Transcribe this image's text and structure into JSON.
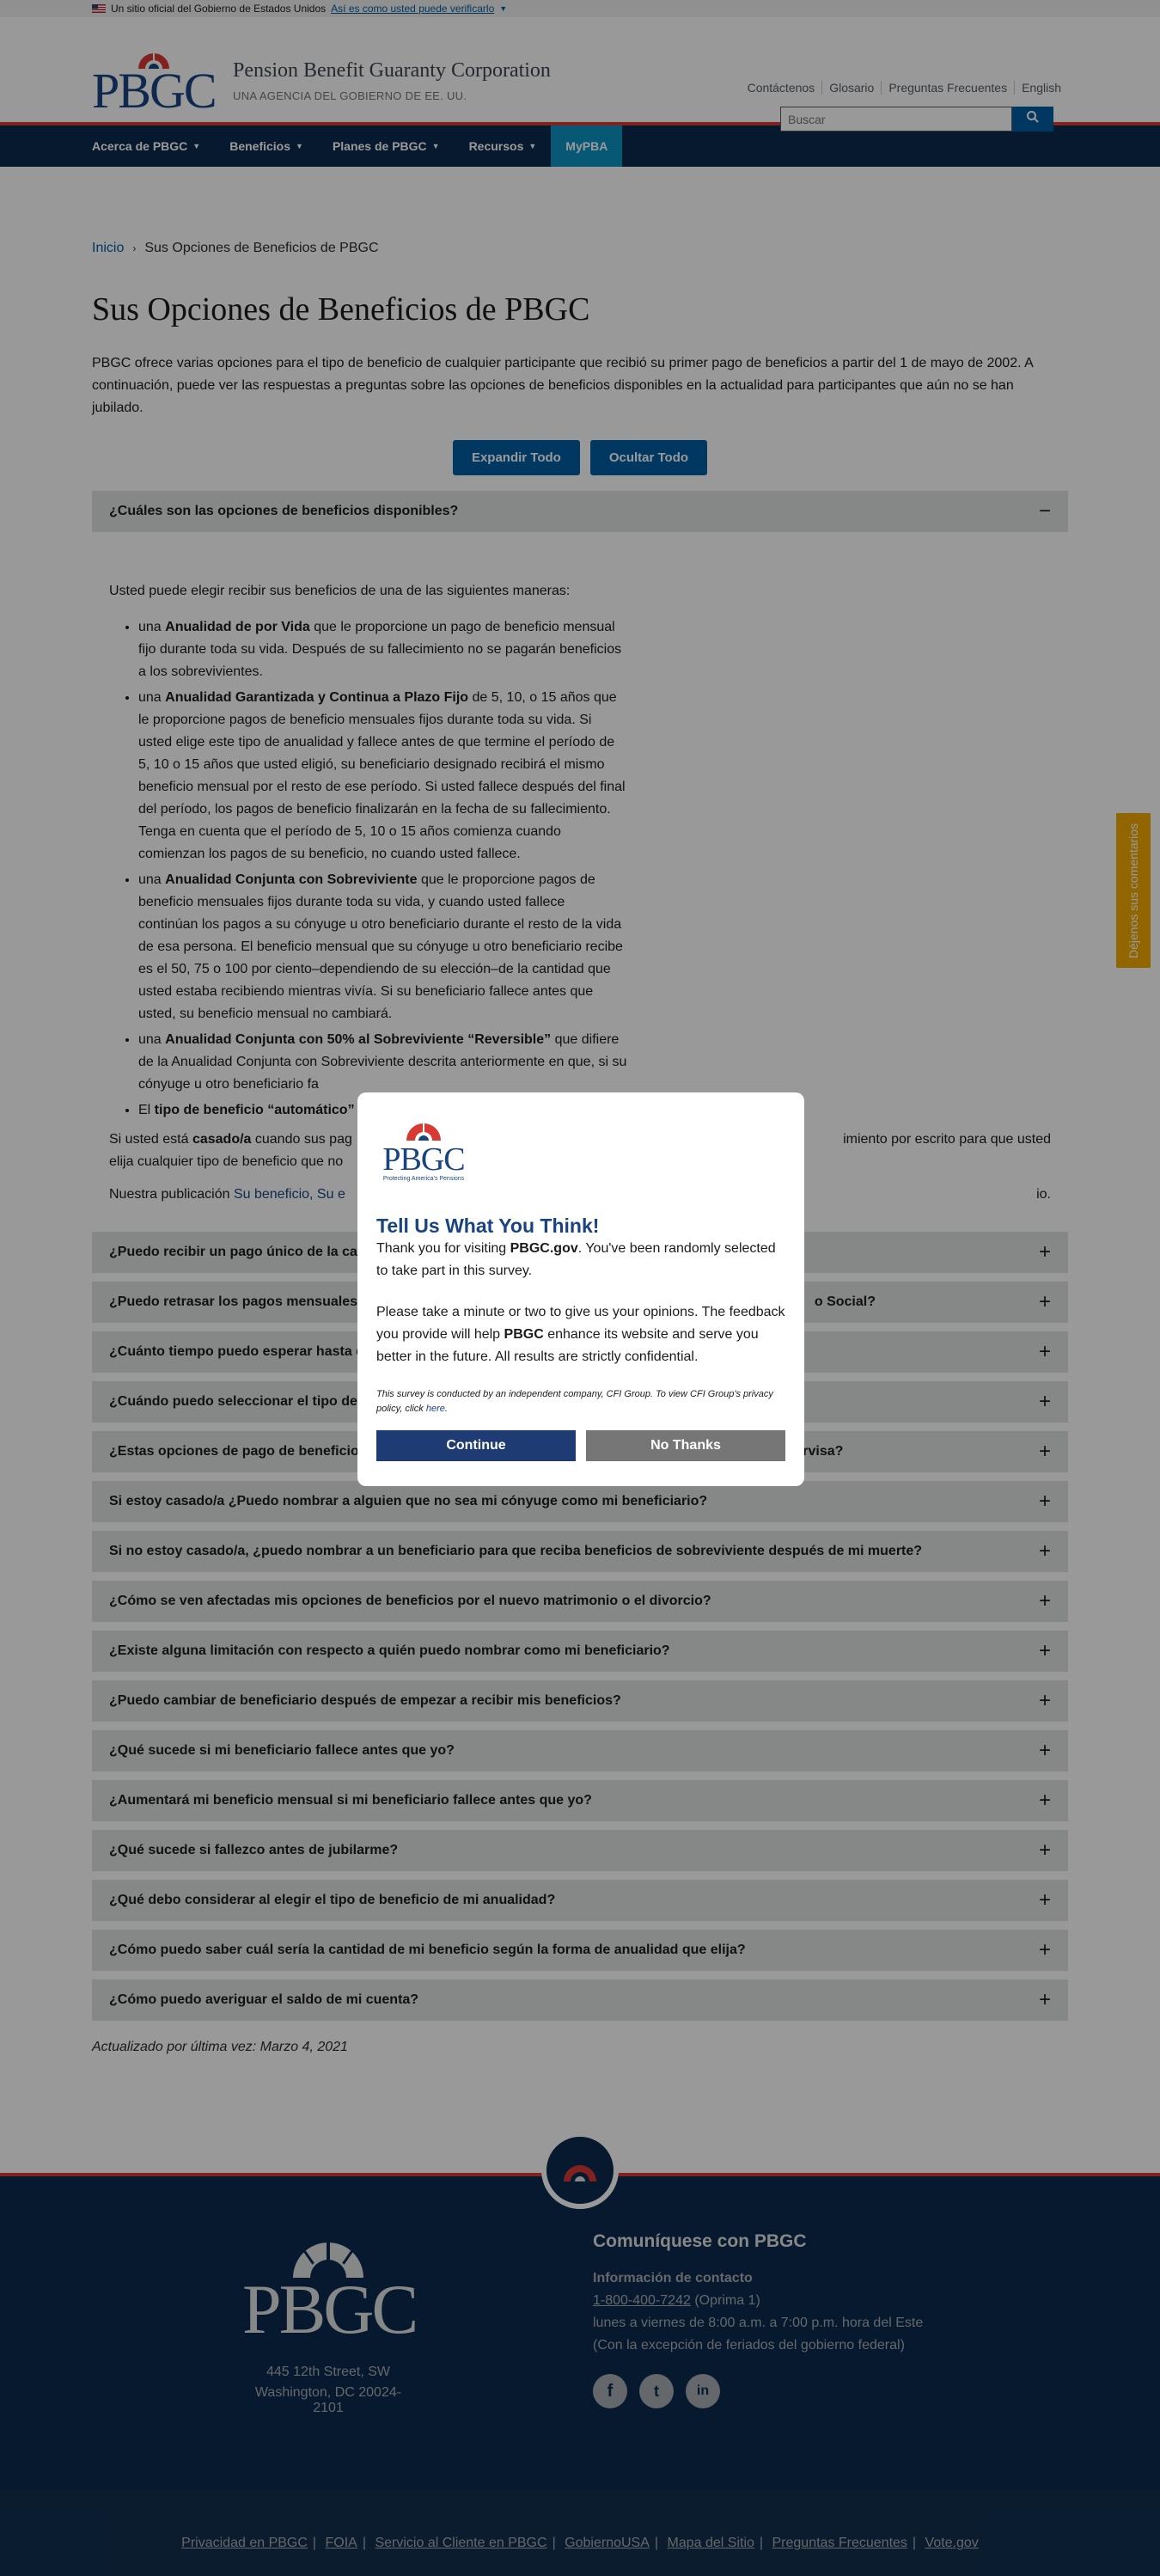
{
  "govbar": {
    "text": "Un sitio oficial del Gobierno de Estados Unidos",
    "link": "Así es como usted puede verificarlo"
  },
  "header": {
    "logo_text": "PBGC",
    "agency_name": "Pension Benefit Guaranty Corporation",
    "agency_sub": "UNA AGENCIA DEL GOBIERNO DE EE. UU.",
    "utility": [
      "Contáctenos",
      "Glosario",
      "Preguntas Frecuentes",
      "English"
    ],
    "search_placeholder": "Buscar"
  },
  "nav": {
    "items": [
      "Acerca de PBGC",
      "Beneficios",
      "Planes de PBGC",
      "Recursos"
    ],
    "mypba": "MyPBA"
  },
  "breadcrumb": {
    "home": "Inicio",
    "current": "Sus Opciones de Beneficios de PBGC"
  },
  "page_title": "Sus Opciones de Beneficios de PBGC",
  "intro": "PBGC ofrece varias opciones para el tipo de beneficio de cualquier participante que recibió su primer pago de beneficios a partir del 1 de mayo de 2002. A continuación, puede ver las respuestas a preguntas sobre las opciones de beneficios disponibles en la actualidad para participantes que aún no se han jubilado.",
  "buttons": {
    "expand": "Expandir Todo",
    "collapse": "Ocultar Todo"
  },
  "first_accordion": {
    "title": "¿Cuáles son las opciones de beneficios disponibles?",
    "lead": "Usted puede elegir recibir sus beneficios de una de las siguientes maneras:",
    "items": [
      {
        "pre": "una ",
        "bold": "Anualidad de por Vida",
        "post": " que le proporcione un pago de beneficio mensual fijo durante toda su vida. Después de su fallecimiento no se pagarán beneficios a los sobrevivientes."
      },
      {
        "pre": "una ",
        "bold": "Anualidad Garantizada y Continua a Plazo Fijo",
        "post": " de 5, 10, o 15 años que le proporcione pagos de beneficio mensuales fijos durante toda su vida. Si usted elige este tipo de anualidad y fallece antes de que termine el período de 5, 10 o 15 años que usted eligió, su beneficiario designado recibirá el mismo beneficio mensual por el resto de ese período. Si usted fallece después del final del período, los pagos de beneficio finalizarán en la fecha de su fallecimiento. Tenga en cuenta que el período de 5, 10 o 15 años comienza cuando comienzan los pagos de su beneficio, no cuando usted fallece."
      },
      {
        "pre": "una ",
        "bold": "Anualidad Conjunta con Sobreviviente",
        "post": " que le proporcione pagos de beneficio mensuales fijos durante toda su vida, y cuando usted fallece continúan los pagos a su cónyuge u otro beneficiario durante el resto de la vida de esa persona. El beneficio mensual que su cónyuge u otro beneficiario recibe es el 50, 75 o 100 por ciento–dependiendo de su elección–de la cantidad que usted estaba recibiendo mientras vivía. Si su beneficiario fallece antes que usted, su beneficio mensual no cambiará."
      },
      {
        "pre": "una ",
        "bold": "Anualidad Conjunta con 50% al Sobreviviente “Reversible”",
        "post": " que difiere de la Anualidad Conjunta con Sobreviviente descrita anteriormente en que, si su cónyuge u otro beneficiario fa"
      },
      {
        "pre": "El ",
        "bold": "tipo de beneficio “automático”",
        "post": ""
      }
    ],
    "married_pre": "Si usted está ",
    "married_bold": "casado/a",
    "married_post": " cuando sus pag",
    "married_tail": "imiento por escrito para que usted",
    "married_line2": "elija cualquier tipo de beneficio que no",
    "pub_pre": "Nuestra publicación ",
    "pub_link": "Su beneficio, Su e",
    "pub_tail": "io."
  },
  "accordions": [
    "¿Puedo recibir un pago único de la can",
    "¿Puedo retrasar los pagos mensuales",
    "¿Cuánto tiempo puedo esperar hasta q",
    "¿Cuándo puedo seleccionar el tipo de",
    "¿Estas opciones de pago de beneficios están disponibles en todos los planes de pensión que PBGC supervisa?",
    "Si estoy casado/a ¿Puedo nombrar a alguien que no sea mi cónyuge como mi beneficiario?",
    "Si no estoy casado/a, ¿puedo nombrar a un beneficiario para que reciba beneficios de sobreviviente después de mi muerte?",
    "¿Cómo se ven afectadas mis opciones de beneficios por el nuevo matrimonio o el divorcio?",
    "¿Existe alguna limitación con respecto a quién puedo nombrar como mi beneficiario?",
    "¿Puedo cambiar de beneficiario después de empezar a recibir mis beneficios?",
    "¿Qué sucede si mi beneficiario fallece antes que yo?",
    "¿Aumentará mi beneficio mensual si mi beneficiario fallece antes que yo?",
    "¿Qué sucede si fallezco antes de jubilarme?",
    "¿Qué debo considerar al elegir el tipo de beneficio de mi anualidad?",
    "¿Cómo puedo saber cuál sería la cantidad de mi beneficio según la forma de anualidad que elija?",
    "¿Cómo puedo averiguar el saldo de mi cuenta?"
  ],
  "accordion_tail_2": "o Social?",
  "updated": "Actualizado por última vez: Marzo 4, 2021",
  "feedback_tab": "Déjenos sus comentarios",
  "modal": {
    "logo_text": "PBGC",
    "logo_tagline": "Protecting America's Pensions",
    "title": "Tell Us What You Think!",
    "p1_pre": "Thank you for visiting ",
    "p1_bold": "PBGC.gov",
    "p1_post": ". You've been randomly selected to take part in this survey.",
    "p2_pre": "Please take a minute or two to give us your opinions. The feedback you provide will help ",
    "p2_bold": "PBGC",
    "p2_post": " enhance its website and serve you better in the future. All results are strictly confidential.",
    "small_pre": "This survey is conducted by an independent company, CFI Group. To view CFI Group's privacy policy, click ",
    "small_link": "here",
    "small_post": ".",
    "continue": "Continue",
    "no_thanks": "No Thanks"
  },
  "footer": {
    "logo_text": "PBGC",
    "address1": "445 12th Street, SW",
    "address2": "Washington, DC 20024-2101",
    "contact_title": "Comuníquese con PBGC",
    "contact_sub": "Información de contacto",
    "phone": "1-800-400-7242",
    "phone_note": " (Oprima 1)",
    "hours": "lunes a viernes de 8:00 a.m. a 7:00 p.m. hora del Este",
    "holidays": "(Con la excepción de feriados del gobierno federal)",
    "social": [
      "f",
      "t",
      "in"
    ],
    "links": [
      "Privacidad en PBGC",
      "FOIA",
      "Servicio al Cliente en PBGC",
      "GobiernoUSA",
      "Mapa del Sitio",
      "Preguntas Frecuentes",
      "Vote.gov"
    ]
  }
}
